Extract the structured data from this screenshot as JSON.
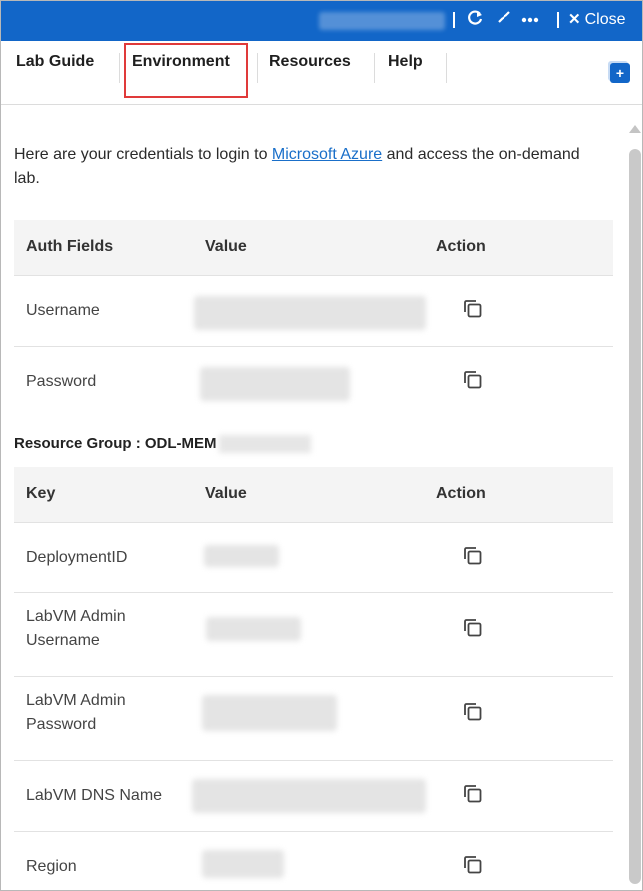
{
  "topbar": {
    "refresh_icon": "refresh-icon",
    "collapse_icon": "collapse-icon",
    "more_icon": "ellipsis-icon",
    "close_label": "Close"
  },
  "tabs": [
    {
      "label": "Lab Guide"
    },
    {
      "label": "Environment"
    },
    {
      "label": "Resources"
    },
    {
      "label": "Help"
    }
  ],
  "intro": {
    "before": "Here are your credentials to login to ",
    "link": "Microsoft Azure",
    "after": " and access the on-demand lab."
  },
  "credentials": {
    "headers": [
      "Auth Fields",
      "Value",
      "Action"
    ],
    "rows": [
      {
        "key": "Username"
      },
      {
        "key": "Password"
      }
    ]
  },
  "resource_group": {
    "title": "Resource Group : ODL-MEM"
  },
  "resources": {
    "headers": [
      "Key",
      "Value",
      "Action"
    ],
    "rows": [
      {
        "key": "DeploymentID"
      },
      {
        "key": "LabVM Admin Username"
      },
      {
        "key": "LabVM Admin Password"
      },
      {
        "key": "LabVM DNS Name"
      },
      {
        "key": "Region"
      }
    ]
  },
  "colors": {
    "accent": "#1266c8",
    "highlight": "#e03a3a",
    "link": "#1a6fc9"
  }
}
